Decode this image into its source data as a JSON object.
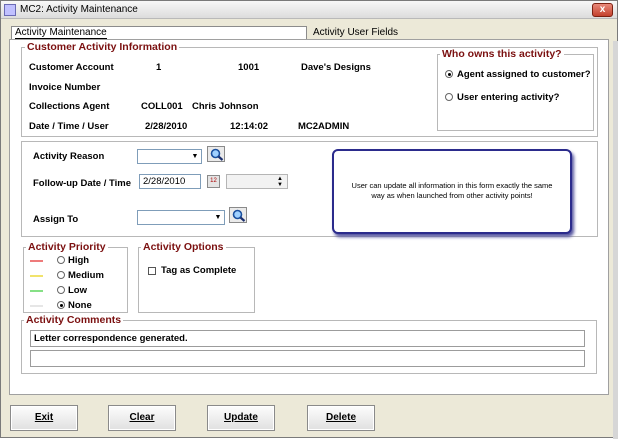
{
  "window": {
    "title": "MC2: Activity Maintenance",
    "close_glyph": "x"
  },
  "tabs": [
    {
      "label": "Activity Maintenance",
      "active": true
    },
    {
      "label": "Activity User Fields",
      "active": false
    }
  ],
  "customer_info": {
    "legend": "Customer Activity Information",
    "rows": [
      {
        "label": "Customer Account",
        "v1": "1",
        "v2": "1001",
        "v3": "Dave's Designs"
      },
      {
        "label": "Invoice Number",
        "v1": "",
        "v2": "",
        "v3": ""
      },
      {
        "label": "Collections Agent",
        "v1": "COLL001",
        "v2": "Chris Johnson",
        "v3": ""
      },
      {
        "label": "Date / Time / User",
        "v1": "2/28/2010",
        "v2": "12:14:02",
        "v3": "MC2ADMIN"
      }
    ]
  },
  "owner": {
    "legend": "Who owns this activity?",
    "options": [
      {
        "label": "Agent assigned to customer?",
        "checked": true
      },
      {
        "label": "User entering activity?",
        "checked": false
      }
    ]
  },
  "form": {
    "activity_reason_label": "Activity Reason",
    "activity_reason_value": "",
    "followup_label": "Follow-up Date / Time",
    "followup_date": "2/28/2010",
    "followup_time": "",
    "assign_to_label": "Assign To",
    "assign_to_value": ""
  },
  "note": "User can update all information in this form exactly the same way as when launched from other activity points!",
  "priority": {
    "legend": "Activity Priority",
    "options": [
      {
        "label": "High",
        "color": "#ee7b7b",
        "checked": false
      },
      {
        "label": "Medium",
        "color": "#f1e36c",
        "checked": false
      },
      {
        "label": "Low",
        "color": "#86e086",
        "checked": false
      },
      {
        "label": "None",
        "color": "#e6e6e6",
        "checked": true
      }
    ]
  },
  "options": {
    "legend": "Activity Options",
    "tag_complete_label": "Tag as Complete",
    "tag_complete_checked": false
  },
  "comments": {
    "legend": "Activity Comments",
    "line1": "Letter correspondence generated.",
    "line2": ""
  },
  "buttons": {
    "exit": "Exit",
    "clear": "Clear",
    "update": "Update",
    "delete": "Delete"
  },
  "colors": {
    "legend": "#7b1010",
    "note_border": "#2b2b8c"
  }
}
